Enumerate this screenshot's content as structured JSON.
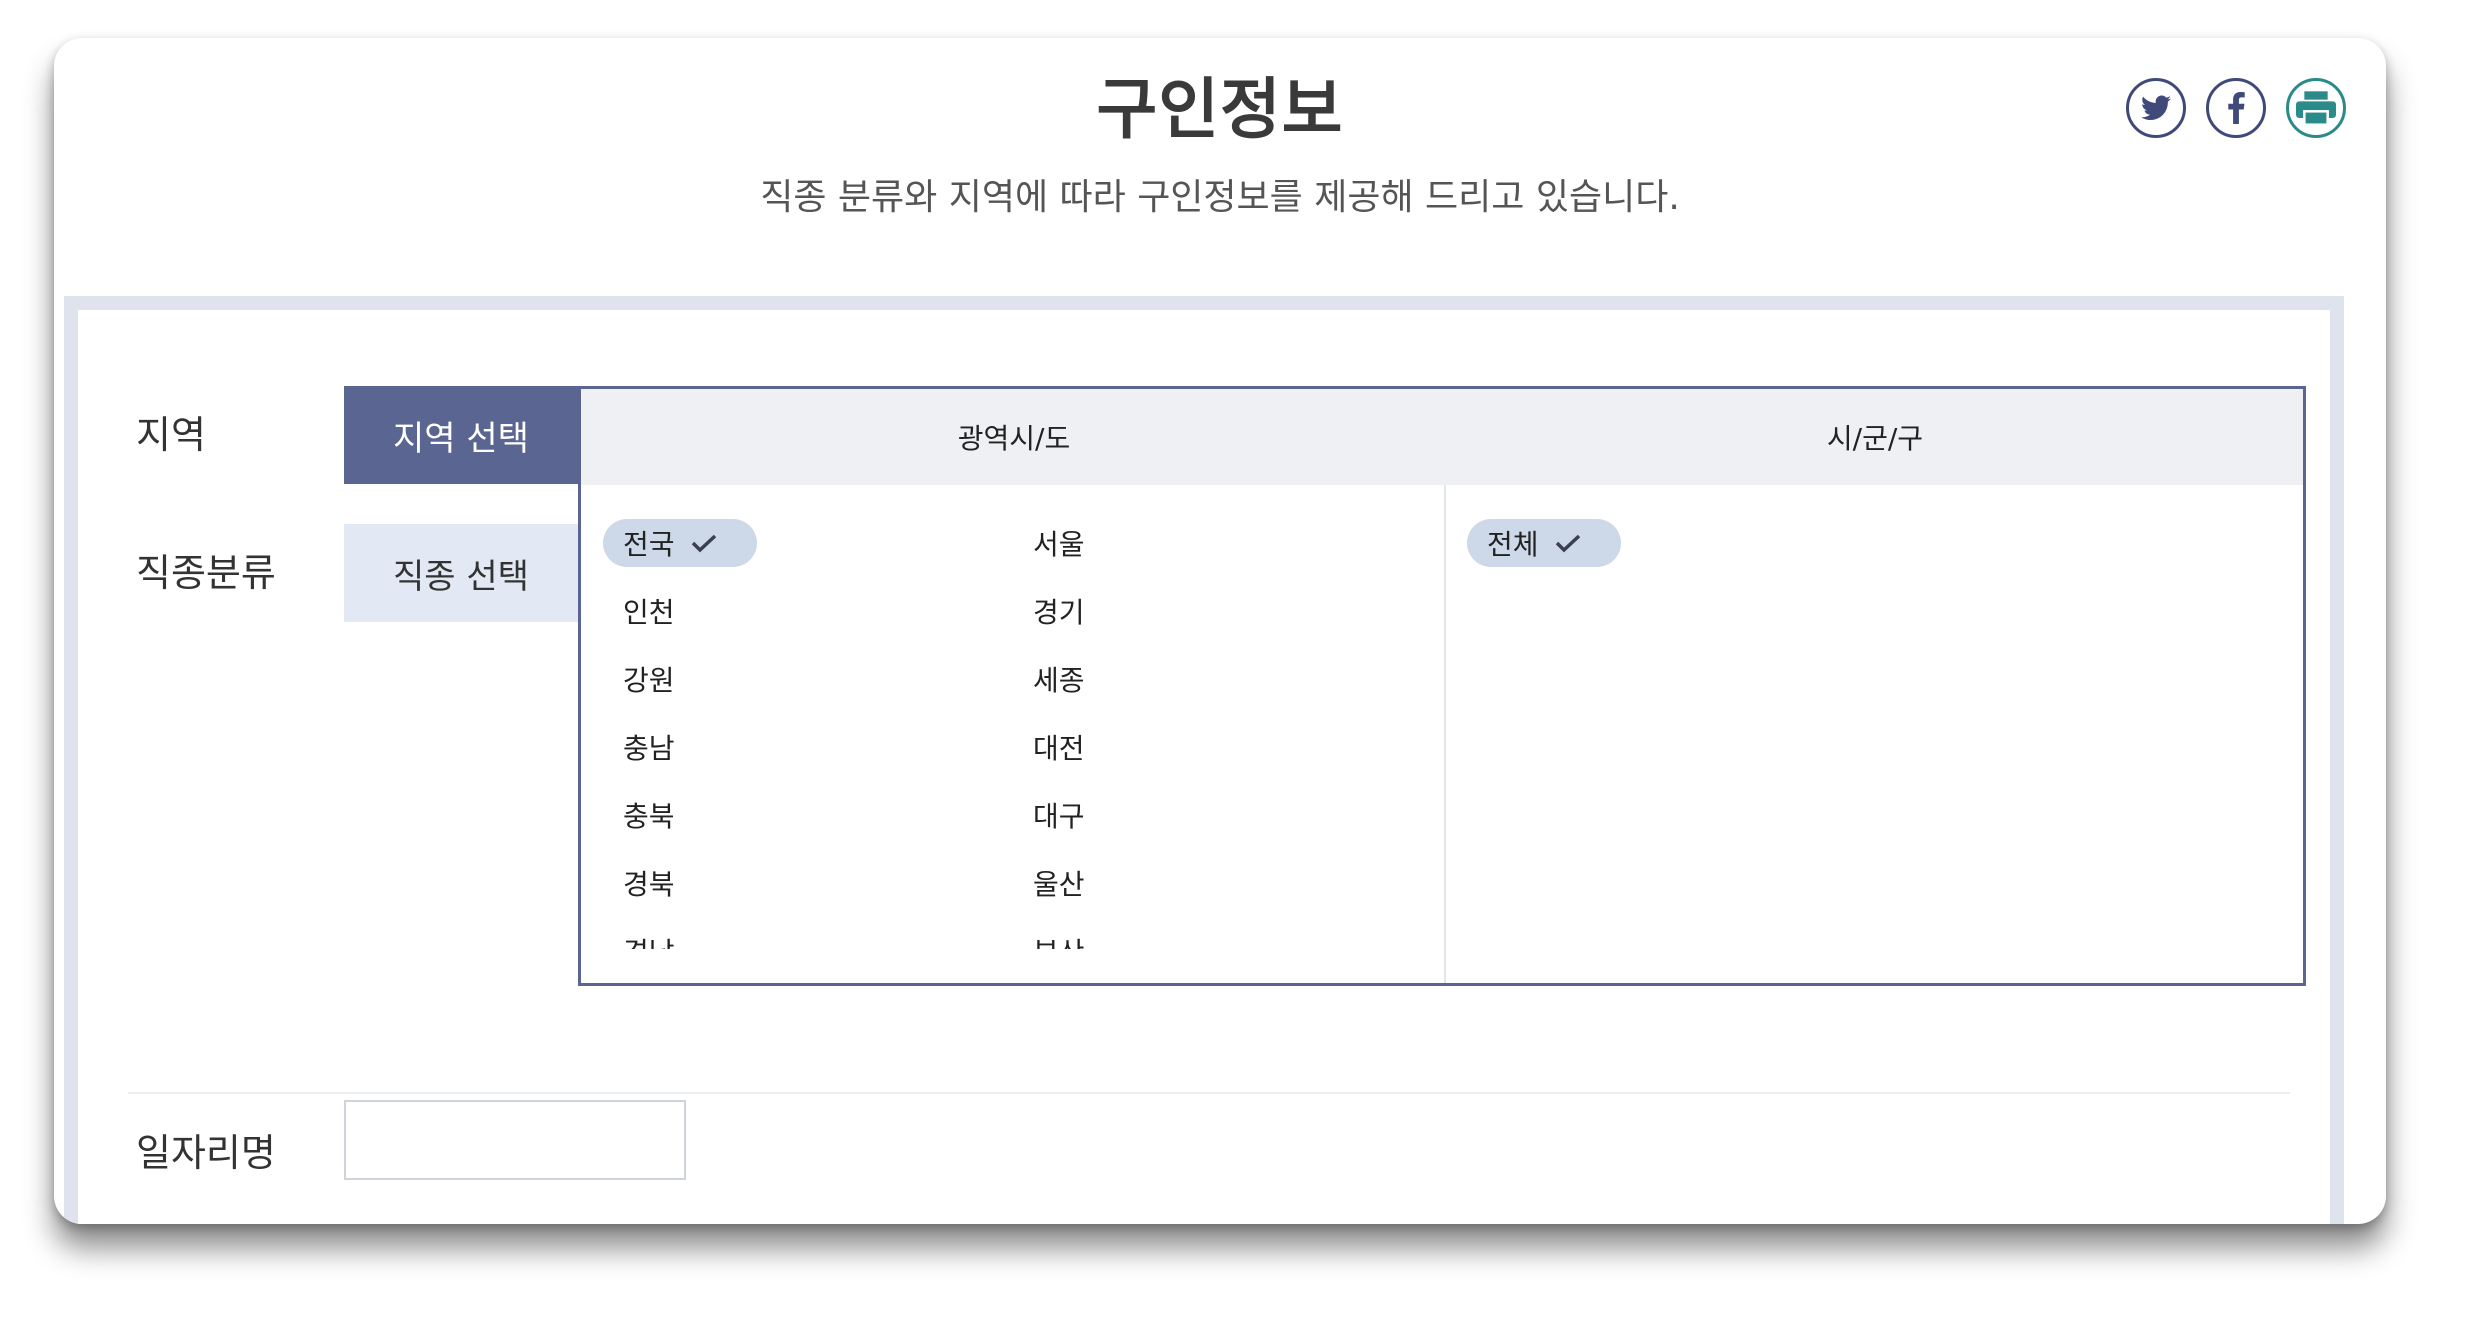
{
  "header": {
    "title": "구인정보",
    "subtitle": "직종 분류와 지역에 따라 구인정보를 제공해 드리고 있습니다."
  },
  "share": {
    "twitter_icon": "twitter-icon",
    "facebook_icon": "facebook-icon",
    "print_icon": "print-icon"
  },
  "form": {
    "region_label": "지역",
    "job_label": "직종분류",
    "job_name_label": "일자리명",
    "job_name_value": "",
    "tabs": {
      "region": "지역 선택",
      "job": "직종 선택"
    }
  },
  "selector": {
    "col_province": "광역시/도",
    "col_city": "시/군/구",
    "provinces": [
      {
        "label": "전국",
        "selected": true
      },
      {
        "label": "서울",
        "selected": false
      },
      {
        "label": "인천",
        "selected": false
      },
      {
        "label": "경기",
        "selected": false
      },
      {
        "label": "강원",
        "selected": false
      },
      {
        "label": "세종",
        "selected": false
      },
      {
        "label": "충남",
        "selected": false
      },
      {
        "label": "대전",
        "selected": false
      },
      {
        "label": "충북",
        "selected": false
      },
      {
        "label": "대구",
        "selected": false
      },
      {
        "label": "경북",
        "selected": false
      },
      {
        "label": "울산",
        "selected": false
      },
      {
        "label": "경남",
        "selected": false
      },
      {
        "label": "부산",
        "selected": false
      }
    ],
    "cities": [
      {
        "label": "전체",
        "selected": true
      }
    ]
  },
  "colors": {
    "accent": "#5a6691",
    "tab_inactive": "#e3e9f4",
    "chip": "#cdd8e8",
    "panel_border": "#dfe3ee"
  }
}
